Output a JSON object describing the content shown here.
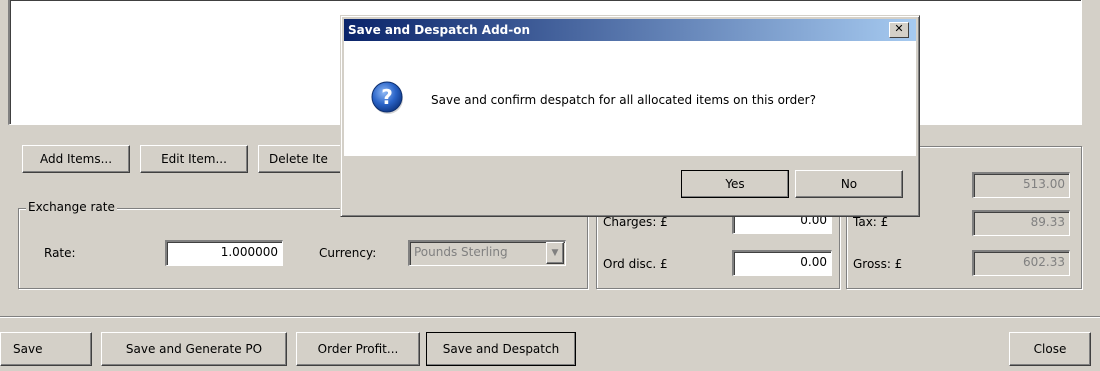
{
  "form": {
    "buttons": {
      "add_items": "Add Items...",
      "edit_item": "Edit Item...",
      "delete_item": "Delete Ite"
    },
    "exchange_rate": {
      "group_label": "Exchange rate",
      "rate_label": "Rate:",
      "rate_value": "1.000000",
      "currency_label": "Currency:",
      "currency_value": "Pounds Sterling"
    },
    "charges": {
      "charges_label": "Charges: £",
      "charges_value": "0.00",
      "ord_disc_label": "Ord disc. £",
      "ord_disc_value": "0.00"
    },
    "totals": {
      "net_value": "513.00",
      "tax_label": "Tax: £",
      "tax_value": "89.33",
      "gross_label": "Gross: £",
      "gross_value": "602.33"
    }
  },
  "bottom_bar": {
    "save": "Save",
    "save_generate_po": "Save and Generate PO",
    "order_profit": "Order Profit...",
    "save_despatch": "Save and Despatch",
    "close": "Close"
  },
  "dialog": {
    "title": "Save and Despatch Add-on",
    "message": "Save and confirm despatch for all allocated items on this order?",
    "icon": "question-icon",
    "yes": "Yes",
    "no": "No",
    "close_glyph": "✕"
  }
}
